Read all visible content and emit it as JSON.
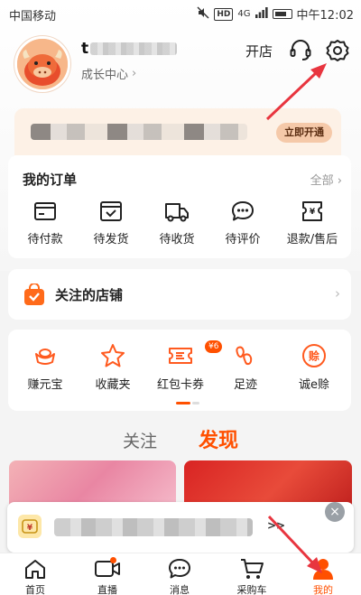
{
  "status_bar": {
    "carrier": "中国移动",
    "hd": "HD",
    "signal": "4G",
    "time": "中午12:02"
  },
  "profile": {
    "username_visible": "t",
    "growth_center": "成长中心",
    "chevron": "›",
    "open_shop": "开店"
  },
  "membership": {
    "activate_label": "立即开通"
  },
  "orders": {
    "title": "我的订单",
    "all_label": "全部 ›",
    "items": [
      {
        "label": "待付款",
        "icon": "wallet-icon"
      },
      {
        "label": "待发货",
        "icon": "box-check-icon"
      },
      {
        "label": "待收货",
        "icon": "truck-icon"
      },
      {
        "label": "待评价",
        "icon": "chat-bubble-icon"
      },
      {
        "label": "退款/售后",
        "icon": "refund-icon"
      }
    ]
  },
  "shops": {
    "title": "关注的店铺",
    "chevron": "›"
  },
  "tools": {
    "items": [
      {
        "label": "赚元宝",
        "icon": "ingot-icon"
      },
      {
        "label": "收藏夹",
        "icon": "star-icon"
      },
      {
        "label": "红包卡券",
        "icon": "coupon-icon"
      },
      {
        "label": "足迹",
        "icon": "footprint-icon"
      },
      {
        "label": "诚e赊",
        "icon": "credit-icon"
      }
    ],
    "coupon_badge": "¥6"
  },
  "feed_tabs": {
    "follow": "关注",
    "discover": "发现"
  },
  "promo": {
    "arrow": ">>",
    "close": "×"
  },
  "bottom_nav": {
    "items": [
      {
        "label": "首页",
        "icon": "home-icon"
      },
      {
        "label": "直播",
        "icon": "video-camera-icon"
      },
      {
        "label": "消息",
        "icon": "message-icon"
      },
      {
        "label": "采购车",
        "icon": "cart-icon"
      },
      {
        "label": "我的",
        "icon": "person-icon"
      }
    ],
    "active": "我的"
  },
  "colors": {
    "accent": "#ff5000",
    "banner_bg": "#fdf1e6",
    "annotation_arrow": "#e8353f"
  }
}
